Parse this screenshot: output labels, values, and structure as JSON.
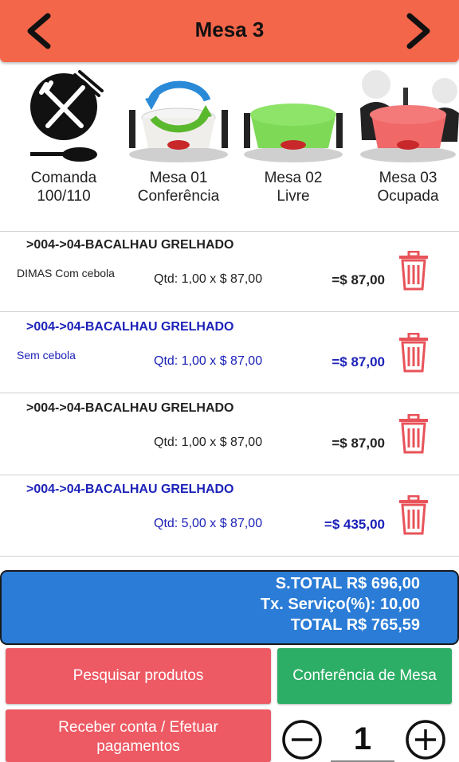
{
  "header": {
    "title": "Mesa 3",
    "prev_icon": "chevron-left-icon",
    "next_icon": "chevron-right-icon"
  },
  "tiles": [
    {
      "line1": "Comanda",
      "line2": "100/110",
      "icon": "no-cutlery-icon"
    },
    {
      "line1": "Mesa 01",
      "line2": "Conferência",
      "icon": "table-refresh-icon",
      "color": "#ffffff"
    },
    {
      "line1": "Mesa 02",
      "line2": "Livre",
      "icon": "table-free-icon",
      "color": "#7ed957"
    },
    {
      "line1": "Mesa 03",
      "line2": "Ocupada",
      "icon": "table-occupied-icon",
      "color": "#f06868"
    }
  ],
  "items": [
    {
      "name": ">004->04-BACALHAU GRELHADO",
      "obs": "DIMAS Com cebola",
      "qtd": "Qtd: 1,00 x $ 87,00",
      "total": "=$ 87,00",
      "color": "#222222"
    },
    {
      "name": ">004->04-BACALHAU GRELHADO",
      "obs": "Sem cebola",
      "qtd": "Qtd: 1,00 x $ 87,00",
      "total": "=$ 87,00",
      "color": "#1c22b8"
    },
    {
      "name": ">004->04-BACALHAU GRELHADO",
      "obs": "",
      "qtd": "Qtd: 1,00 x $ 87,00",
      "total": "=$ 87,00",
      "color": "#222222"
    },
    {
      "name": ">004->04-BACALHAU GRELHADO",
      "obs": "",
      "qtd": "Qtd: 5,00 x $ 87,00",
      "total": "=$ 435,00",
      "color": "#1c22b8"
    }
  ],
  "totals": {
    "subtotal": "S.TOTAL R$ 696,00",
    "service": "Tx. Serviço(%): 10,00",
    "total": "TOTAL R$ 765,59"
  },
  "buttons": {
    "search": "Pesquisar produtos",
    "conference": "Conferência de Mesa",
    "pay_line1": "Receber conta / Efetuar",
    "pay_line2": "pagamentos"
  },
  "quantity": "1",
  "colors": {
    "header": "#f4664a",
    "totals": "#2a7cd6",
    "red_button": "#ed5a64",
    "green_button": "#2dae66",
    "trash": "#e8535a"
  }
}
